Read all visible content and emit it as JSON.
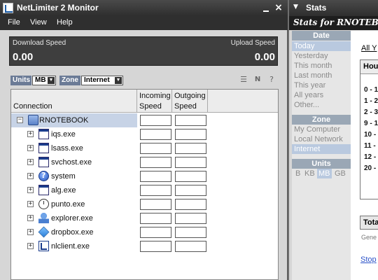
{
  "window": {
    "title": "NetLimiter 2 Monitor",
    "close_glyph": "×"
  },
  "menu": {
    "items": [
      "File",
      "View",
      "Help"
    ]
  },
  "speed": {
    "download_label": "Download Speed",
    "download_value": "0.00",
    "upload_label": "Upload Speed",
    "upload_value": "0.00"
  },
  "filters": {
    "units_label": "Units",
    "units_value": "MB",
    "zone_label": "Zone",
    "zone_value": "Internet"
  },
  "grid": {
    "col_connection": "Connection",
    "col_incoming_1": "Incoming",
    "col_incoming_2": "Speed",
    "col_outgoing_1": "Outgoing",
    "col_outgoing_2": "Speed",
    "root": {
      "label": "RNOTEBOOK",
      "expander": "−",
      "icon": "computer-icon"
    },
    "rows": [
      {
        "label": "iqs.exe",
        "icon": "application-icon"
      },
      {
        "label": "lsass.exe",
        "icon": "application-icon"
      },
      {
        "label": "svchost.exe",
        "icon": "application-icon"
      },
      {
        "label": "system",
        "icon": "help-globe-icon"
      },
      {
        "label": "alg.exe",
        "icon": "application-icon"
      },
      {
        "label": "punto.exe",
        "icon": "clock-icon"
      },
      {
        "label": "explorer.exe",
        "icon": "explorer-icon"
      },
      {
        "label": "dropbox.exe",
        "icon": "dropbox-icon"
      },
      {
        "label": "nlclient.exe",
        "icon": "netlimiter-icon"
      }
    ]
  },
  "stats": {
    "title": "Stats",
    "header": "Stats for RNOTEBOOK",
    "date": {
      "heading": "Date",
      "options": [
        "Today",
        "Yesterday",
        "This month",
        "Last month",
        "This year",
        "All years",
        "Other..."
      ],
      "selected": "Today"
    },
    "zone": {
      "heading": "Zone",
      "options": [
        "My Computer",
        "Local Network",
        "Internet"
      ],
      "selected": "Internet"
    },
    "units": {
      "heading": "Units",
      "options": [
        "B",
        "KB",
        "MB",
        "GB"
      ],
      "selected": "MB"
    },
    "content": {
      "link_all": "All Y",
      "table_head": "Hou",
      "hours": [
        "0 - 1",
        "1 - 2",
        "2 - 3",
        "9 - 1",
        "10 -",
        "11 -",
        "12 -",
        "20 -"
      ],
      "total": "Tota",
      "generated": "Gene",
      "stop": "Stop"
    }
  }
}
